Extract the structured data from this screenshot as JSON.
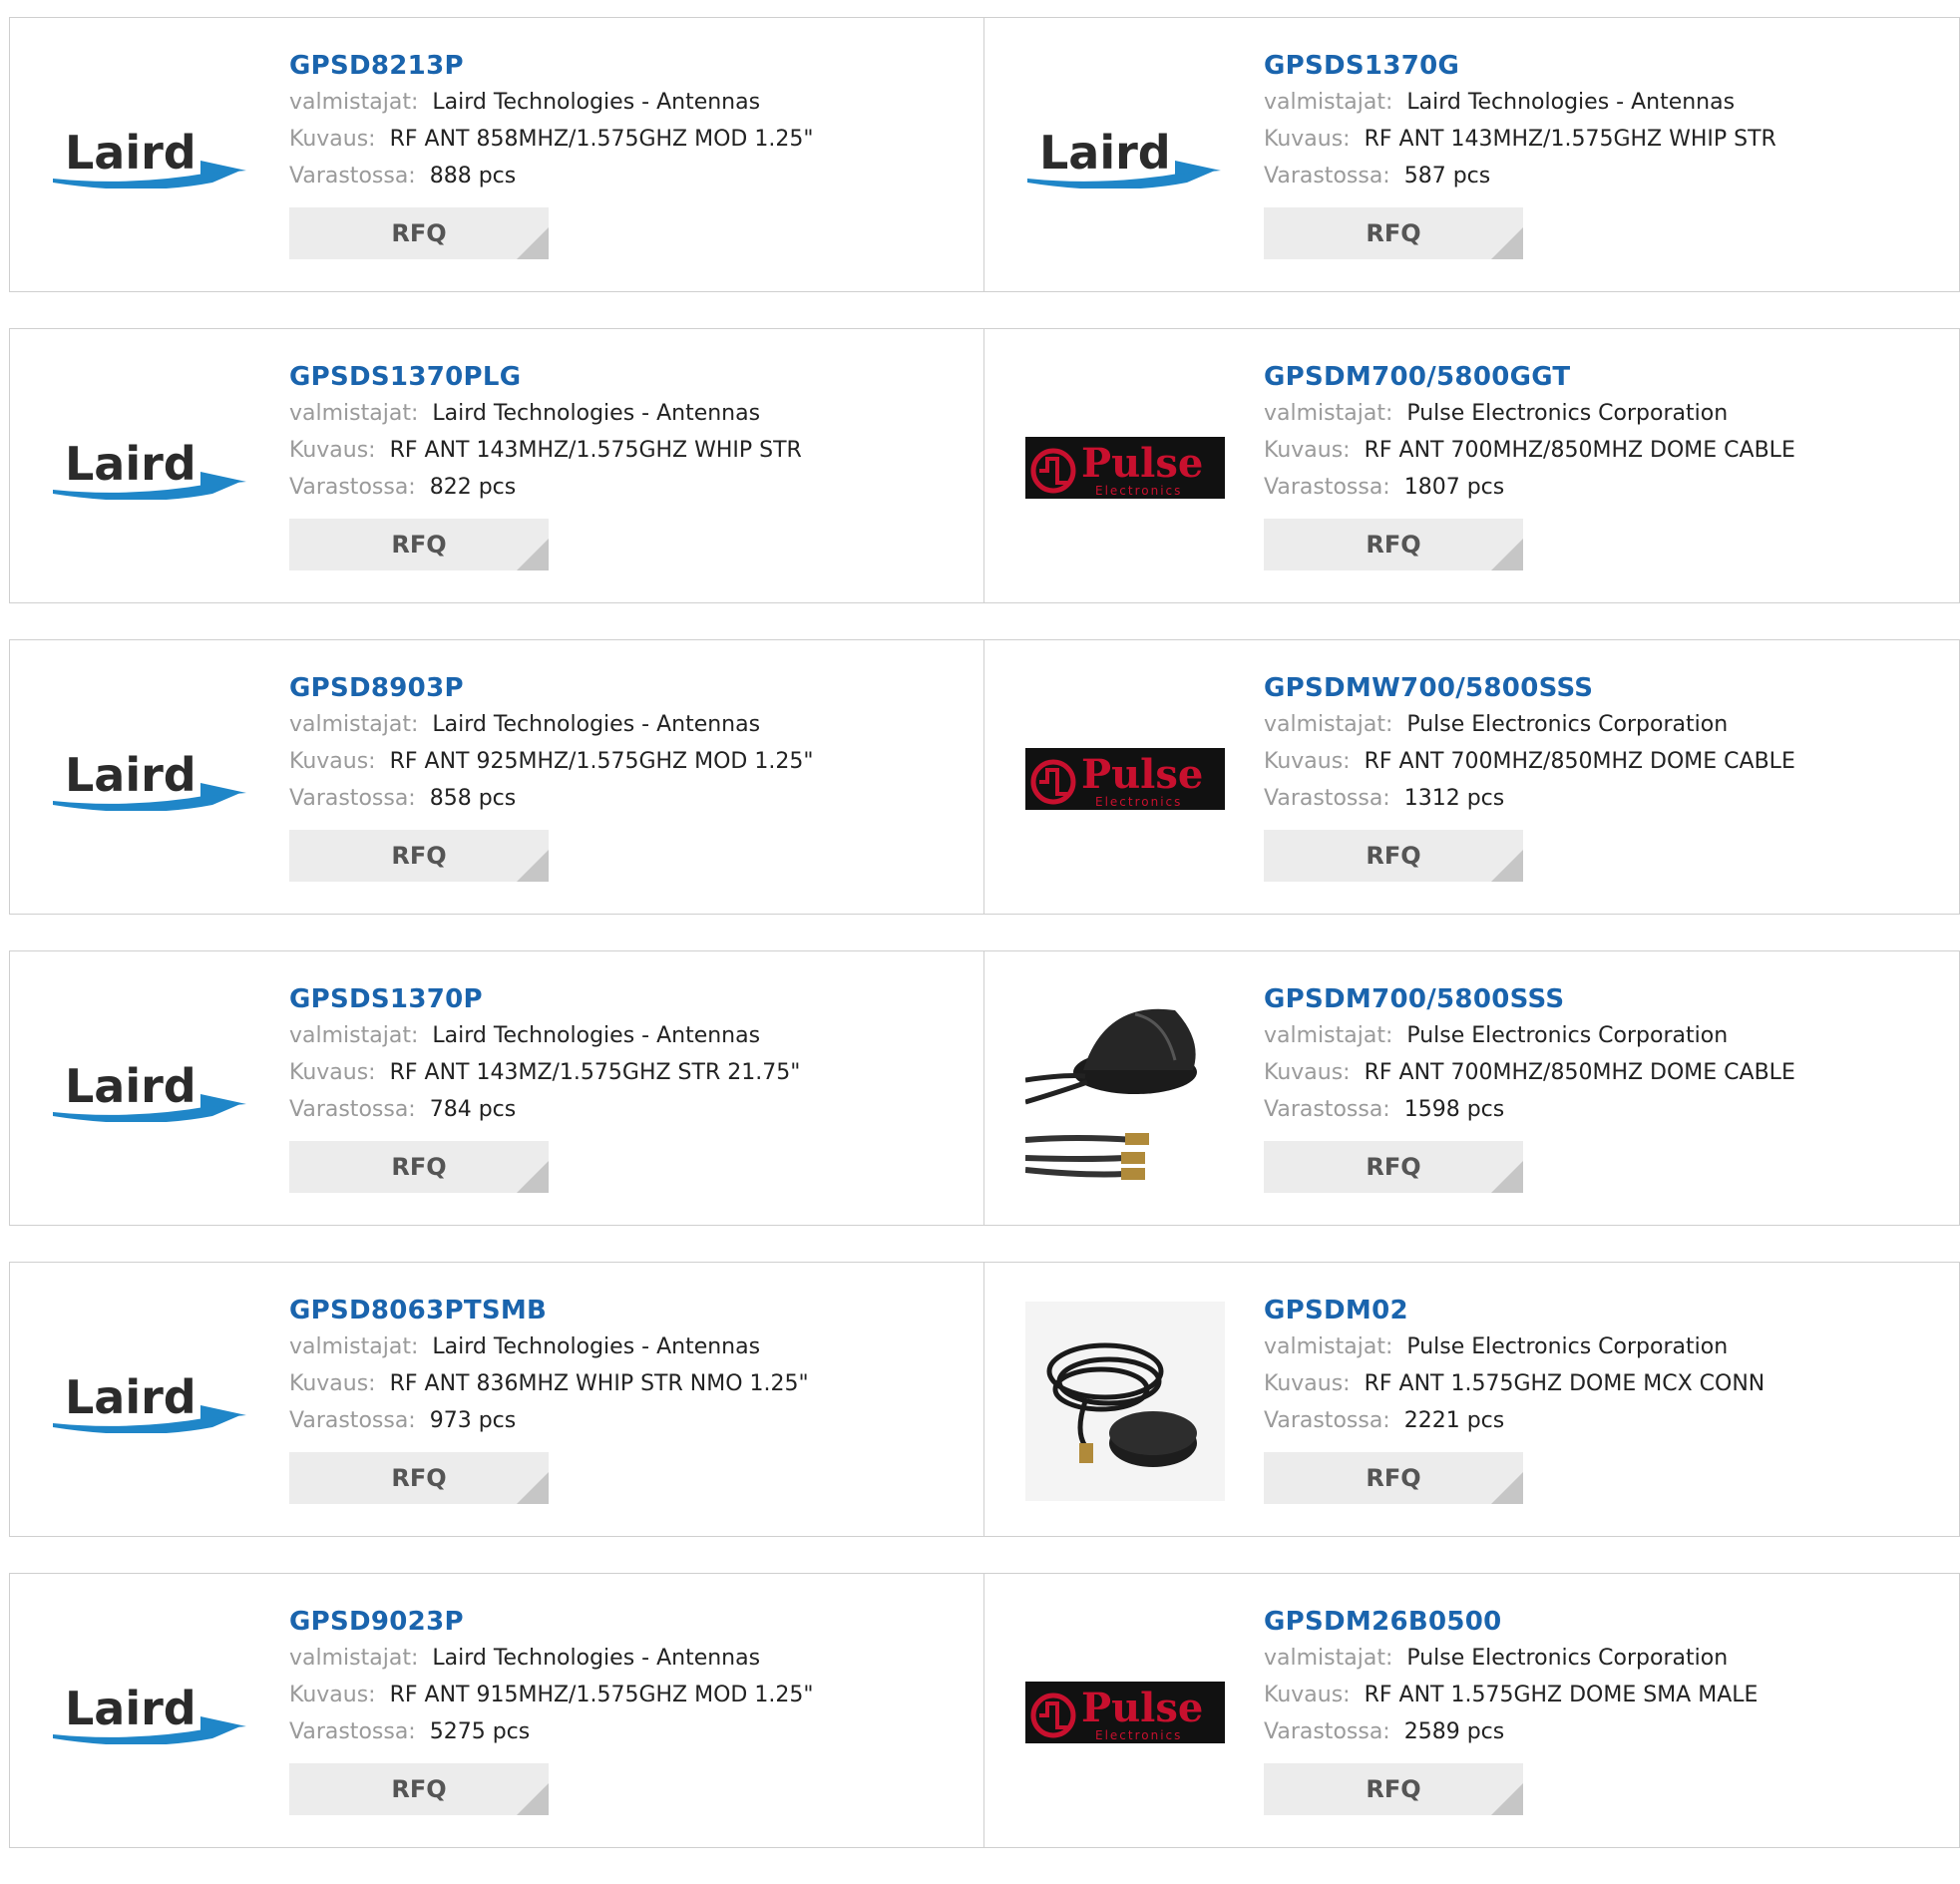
{
  "labels": {
    "manufacturer": "valmistajat:",
    "description": "Kuvaus:",
    "stock": "Varastossa:",
    "rfq": "RFQ"
  },
  "logos": {
    "laird": "Laird",
    "pulse": "Pulse",
    "pulse_sub": "Electronics"
  },
  "products": [
    {
      "pn": "GPSD8213P",
      "manufacturer": "Laird Technologies - Antennas",
      "description": "RF ANT 858MHZ/1.575GHZ MOD 1.25\"",
      "stock": "888 pcs",
      "logo": "laird"
    },
    {
      "pn": "GPSDS1370G",
      "manufacturer": "Laird Technologies - Antennas",
      "description": "RF ANT 143MHZ/1.575GHZ WHIP STR",
      "stock": "587 pcs",
      "logo": "laird"
    },
    {
      "pn": "GPSDS1370PLG",
      "manufacturer": "Laird Technologies - Antennas",
      "description": "RF ANT 143MHZ/1.575GHZ WHIP STR",
      "stock": "822 pcs",
      "logo": "laird"
    },
    {
      "pn": "GPSDM700/5800GGT",
      "manufacturer": "Pulse Electronics Corporation",
      "description": "RF ANT 700MHZ/850MHZ DOME CABLE",
      "stock": "1807 pcs",
      "logo": "pulse"
    },
    {
      "pn": "GPSD8903P",
      "manufacturer": "Laird Technologies - Antennas",
      "description": "RF ANT 925MHZ/1.575GHZ MOD 1.25\"",
      "stock": "858 pcs",
      "logo": "laird"
    },
    {
      "pn": "GPSDMW700/5800SSS",
      "manufacturer": "Pulse Electronics Corporation",
      "description": "RF ANT 700MHZ/850MHZ DOME CABLE",
      "stock": "1312 pcs",
      "logo": "pulse"
    },
    {
      "pn": "GPSDS1370P",
      "manufacturer": "Laird Technologies - Antennas",
      "description": "RF ANT 143MZ/1.575GHZ STR 21.75\"",
      "stock": "784 pcs",
      "logo": "laird"
    },
    {
      "pn": "GPSDM700/5800SSS",
      "manufacturer": "Pulse Electronics Corporation",
      "description": "RF ANT 700MHZ/850MHZ DOME CABLE",
      "stock": "1598 pcs",
      "logo": "dome-cable-photo"
    },
    {
      "pn": "GPSD8063PTSMB",
      "manufacturer": "Laird Technologies - Antennas",
      "description": "RF ANT 836MHZ WHIP STR NMO 1.25\"",
      "stock": "973 pcs",
      "logo": "laird"
    },
    {
      "pn": "GPSDM02",
      "manufacturer": "Pulse Electronics Corporation",
      "description": "RF ANT 1.575GHZ DOME MCX CONN",
      "stock": "2221 pcs",
      "logo": "puck-antenna-photo"
    },
    {
      "pn": "GPSD9023P",
      "manufacturer": "Laird Technologies - Antennas",
      "description": "RF ANT 915MHZ/1.575GHZ MOD 1.25\"",
      "stock": "5275 pcs",
      "logo": "laird"
    },
    {
      "pn": "GPSDM26B0500",
      "manufacturer": "Pulse Electronics Corporation",
      "description": "RF ANT 1.575GHZ DOME SMA MALE",
      "stock": "2589 pcs",
      "logo": "pulse"
    }
  ]
}
